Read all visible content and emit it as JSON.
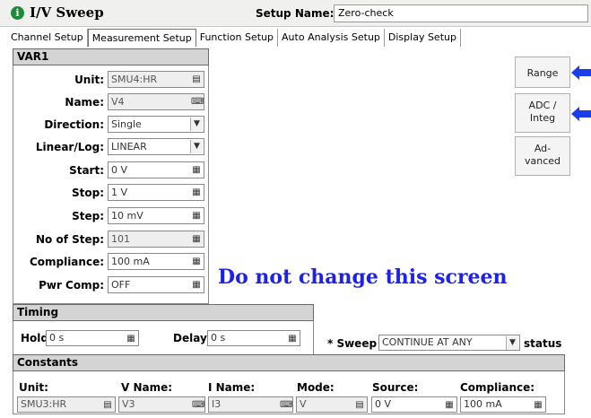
{
  "window": {
    "title": "I/V Sweep",
    "app_icon": "info-icon",
    "setup_name_label": "Setup Name:",
    "setup_name_value": "Zero-check"
  },
  "tabs": [
    {
      "label": "Channel Setup",
      "active": false
    },
    {
      "label": "Measurement Setup",
      "active": true
    },
    {
      "label": "Function Setup",
      "active": false
    },
    {
      "label": "Auto Analysis Setup",
      "active": false
    },
    {
      "label": "Display Setup",
      "active": false
    }
  ],
  "var1": {
    "header": "VAR1",
    "rows": [
      {
        "label": "Unit:",
        "value": "SMU4:HR",
        "readonly": true,
        "control": "picker"
      },
      {
        "label": "Name:",
        "value": "V4",
        "readonly": true,
        "control": "keyboard"
      },
      {
        "label": "Direction:",
        "value": "Single",
        "readonly": false,
        "control": "dropdown"
      },
      {
        "label": "Linear/Log:",
        "value": "LINEAR",
        "readonly": false,
        "control": "dropdown"
      },
      {
        "label": "Start:",
        "value": "0 V",
        "readonly": false,
        "control": "calculator"
      },
      {
        "label": "Stop:",
        "value": "1 V",
        "readonly": false,
        "control": "calculator"
      },
      {
        "label": "Step:",
        "value": "10 mV",
        "readonly": false,
        "control": "calculator"
      },
      {
        "label": "No of Step:",
        "value": "101",
        "readonly": true,
        "control": "calculator"
      },
      {
        "label": "Compliance:",
        "value": "100 mA",
        "readonly": false,
        "control": "calculator"
      },
      {
        "label": "Pwr Comp:",
        "value": "OFF",
        "readonly": false,
        "control": "calculator"
      }
    ]
  },
  "side_buttons": {
    "range": "Range",
    "adc_line1": "ADC /",
    "adc_line2": "Integ",
    "advanced_line1": "Ad-",
    "advanced_line2": "vanced"
  },
  "annotation": {
    "notice": "Do not change this screen",
    "arrow_color": "#1a3ee8"
  },
  "timing": {
    "header": "Timing",
    "hold_label": "Hold:",
    "hold_value": "0 s",
    "delay_label": "Delay:",
    "delay_value": "0 s",
    "sweep_prefix": "* Sweep",
    "sweep_value": "CONTINUE AT ANY",
    "sweep_suffix": "status"
  },
  "constants": {
    "header": "Constants",
    "columns": {
      "unit": "Unit:",
      "v_name": "V Name:",
      "i_name": "I Name:",
      "mode": "Mode:",
      "source": "Source:",
      "compliance": "Compliance:"
    },
    "row": {
      "unit": "SMU3:HR",
      "v_name": "V3",
      "i_name": "I3",
      "mode": "V",
      "source": "0 V",
      "compliance": "100 mA"
    }
  }
}
